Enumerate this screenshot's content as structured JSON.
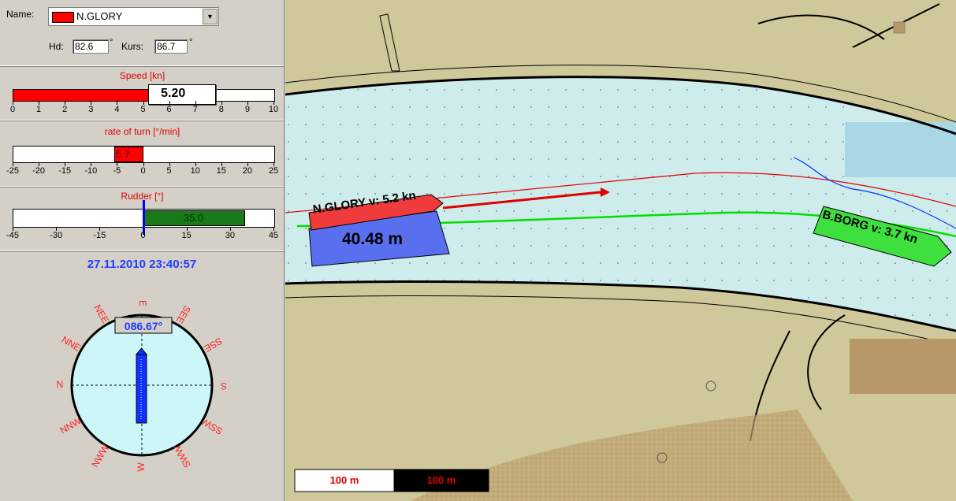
{
  "panel": {
    "name_label": "Name:",
    "vessel_name": "N.GLORY",
    "vessel_color": "#ff0000",
    "hd_label": "Hd:",
    "hd_value": "82.6",
    "hd_unit": "°",
    "kurs_label": "Kurs:",
    "kurs_value": "86.7",
    "kurs_unit": "°"
  },
  "speed": {
    "title": "Speed [kn]",
    "value_text": "5.20",
    "value": 5.2,
    "min": 0,
    "max": 10,
    "ticks": [
      "0",
      "1",
      "2",
      "3",
      "4",
      "5",
      "6",
      "7",
      "8",
      "9",
      "10"
    ],
    "fill_color": "#ff0000"
  },
  "rot": {
    "title": "rate of turn [°/min]",
    "value_text": "5.7",
    "value": -5.7,
    "min": -25,
    "max": 25,
    "ticks": [
      "-25",
      "-20",
      "-15",
      "-10",
      "-5",
      "0",
      "5",
      "10",
      "15",
      "20",
      "25"
    ],
    "fill_color": "#ff0000"
  },
  "rudder": {
    "title": "Rudder [°]",
    "value_text": "35.0",
    "value": 35.0,
    "min": -45,
    "max": 45,
    "ticks": [
      "-45",
      "-30",
      "-15",
      "0",
      "15",
      "30",
      "45"
    ],
    "fill_color": "#1a7a1a"
  },
  "datetime": "27.11.2010 23:40:57",
  "compass": {
    "heading_text": "086.67°",
    "heading": 86.67,
    "labels": [
      "E",
      "SEE",
      "SSE",
      "S",
      "SSW",
      "SWW",
      "W",
      "NWW",
      "NNW",
      "N",
      "NNE",
      "NEE"
    ]
  },
  "map": {
    "own_ship_label": "N.GLORY v: 5.2 kn",
    "distance_label": "40.48 m",
    "other_ship_label": "B.BORG v: 3.7 kn",
    "scale_white": "100 m",
    "scale_black": "100 m",
    "water_color": "#cdeceb",
    "land_color": "#cfc89a"
  }
}
